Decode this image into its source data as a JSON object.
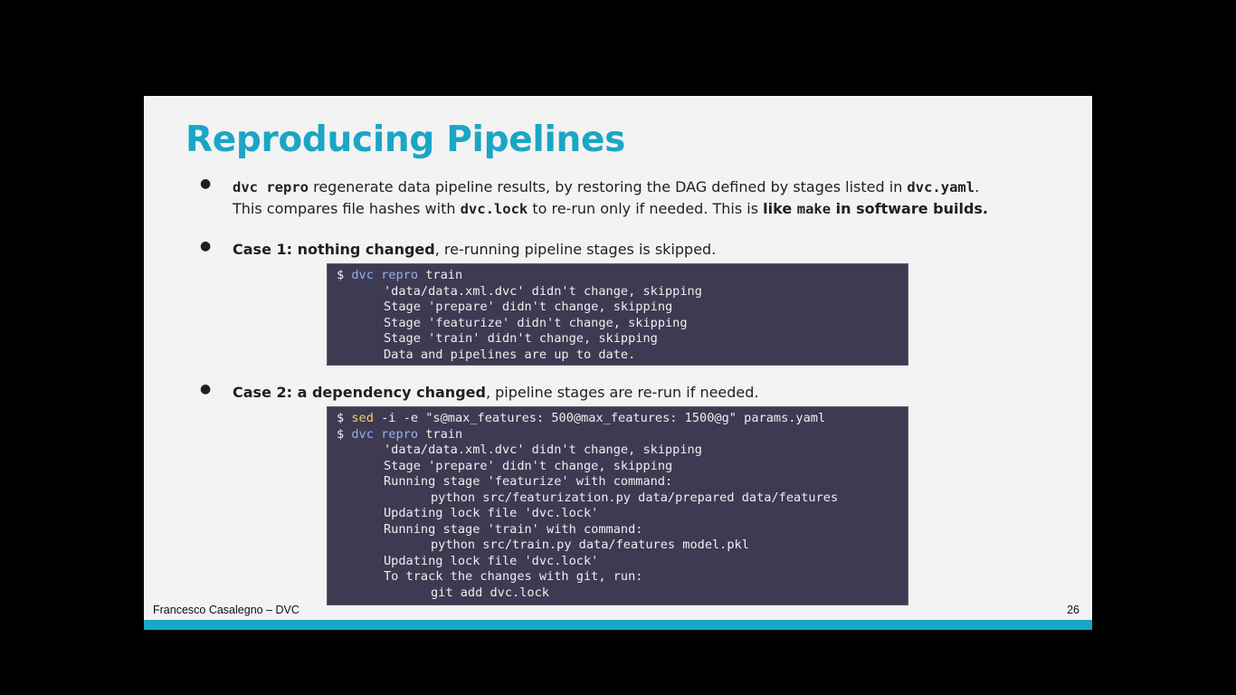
{
  "slide": {
    "title": "Reproducing Pipelines",
    "bullet1": {
      "cmd": "dvc repro",
      "text_a": " regenerate data pipeline results, by restoring the DAG defined by stages listed in ",
      "file_yaml": "dvc.yaml",
      "text_b": ".",
      "text_c": "This compares file hashes with ",
      "file_lock": "dvc.lock",
      "text_d": " to re-run only if needed. This is ",
      "bold_like": "like ",
      "make": "make",
      "bold_rest": " in software builds."
    },
    "bullet2": {
      "bold": "Case 1: nothing changed",
      "rest": ", re-running pipeline stages is skipped."
    },
    "terminal1": {
      "prompt": "$ ",
      "cmd_dvc": "dvc",
      "cmd_repro": "repro",
      "cmd_arg": " train",
      "lines": [
        "'data/data.xml.dvc' didn't change, skipping",
        "Stage 'prepare' didn't change, skipping",
        "Stage 'featurize' didn't change, skipping",
        "Stage 'train' didn't change, skipping",
        "Data and pipelines are up to date."
      ]
    },
    "bullet3": {
      "bold": "Case 2: a dependency changed",
      "rest": ", pipeline stages are re-run if needed."
    },
    "terminal2": {
      "prompt": "$ ",
      "sed": "sed",
      "sed_args": " -i -e \"s@max_features: 500@max_features: 1500@g\" params.yaml",
      "cmd_dvc": "dvc",
      "cmd_repro": "repro",
      "cmd_arg": " train",
      "l1": "'data/data.xml.dvc' didn't change, skipping",
      "l2": "Stage 'prepare' didn't change, skipping",
      "l3": "Running stage 'featurize' with command:",
      "l4": "python src/featurization.py data/prepared data/features",
      "l5": "Updating lock file 'dvc.lock'",
      "l6": "Running stage 'train' with command:",
      "l7": "python src/train.py data/features model.pkl",
      "l8": "Updating lock file 'dvc.lock'",
      "l9": "To track the changes with git, run:",
      "l10": "git add dvc.lock"
    },
    "footer_left": "Francesco Casalegno – DVC",
    "page_number": "26",
    "accent_color": "#1aa6c5",
    "terminal_bg": "#3e3a52"
  }
}
